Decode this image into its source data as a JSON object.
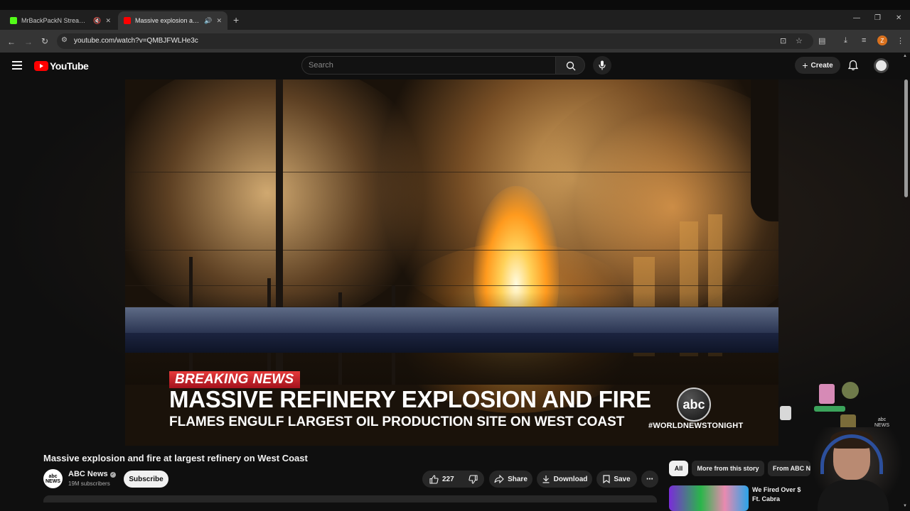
{
  "browser": {
    "tabs": [
      {
        "title": "MrBackPackN Stream - Watch",
        "favicon_color": "#53fc18"
      },
      {
        "title": "Massive explosion and fire at largest refinery on West Coast",
        "favicon_color": "#ff0000"
      }
    ],
    "url": "youtube.com/watch?v=QMBJFWLHe3c",
    "profile_initial": "Z"
  },
  "header": {
    "logo_text": "YouTube",
    "search_placeholder": "Search",
    "create_label": "Create"
  },
  "video": {
    "overlay": {
      "breaking": "BREAKING NEWS",
      "headline": "MASSIVE REFINERY EXPLOSION AND FIRE",
      "subhead": "FLAMES ENGULF LARGEST OIL PRODUCTION SITE ON WEST COAST",
      "network_logo": "abc",
      "hashtag": "#WORLDNEWSTONIGHT"
    }
  },
  "meta": {
    "title": "Massive explosion and fire at largest refinery on West Coast",
    "channel": {
      "name": "ABC News",
      "avatar_text_1": "abc",
      "avatar_text_2": "NEWS",
      "subscribers": "19M subscribers"
    },
    "subscribe_label": "Subscribe"
  },
  "actions": {
    "like_count": "227",
    "share_label": "Share",
    "download_label": "Download",
    "save_label": "Save"
  },
  "chips": [
    {
      "label": "All",
      "active": true
    },
    {
      "label": "More from this story",
      "active": false
    },
    {
      "label": "From ABC News",
      "active": false
    }
  ],
  "recommendation": {
    "title_line1": "We Fired Over $",
    "title_line2": "Ft. Cabra"
  },
  "stream_overlay": {
    "news_line1": "abc",
    "news_line2": "NEWS"
  }
}
